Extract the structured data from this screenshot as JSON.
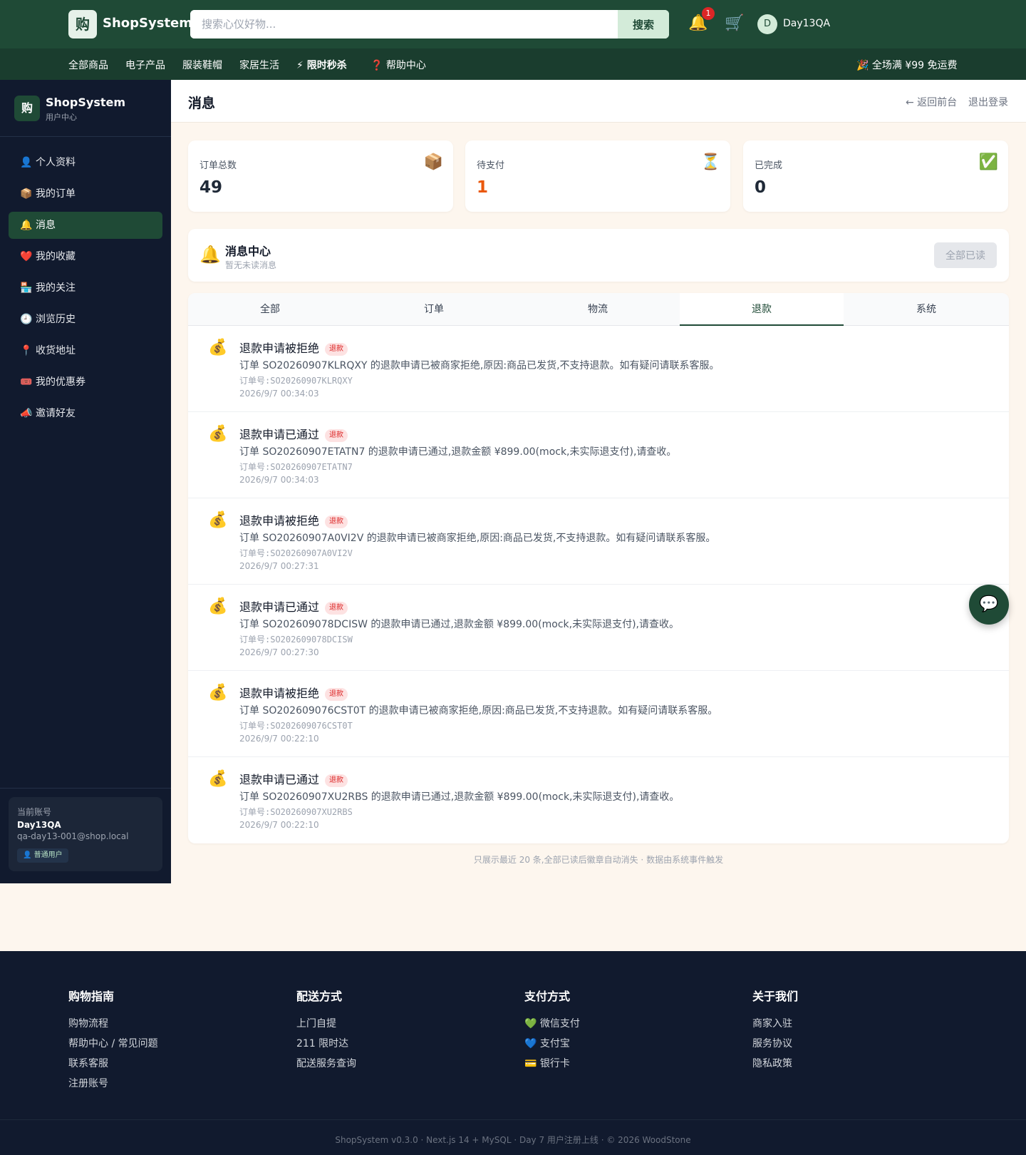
{
  "header": {
    "logo_char": "购",
    "brand": "ShopSystem",
    "search_placeholder": "搜索心仪好物...",
    "search_button": "搜索",
    "notification_count": "1",
    "user_initial": "D",
    "username": "Day13QA"
  },
  "nav": {
    "items": [
      "全部商品",
      "电子产品",
      "服装鞋帽",
      "家居生活",
      "⚡ 限时秒杀",
      "❓ 帮助中心"
    ],
    "promo": "🎉 全场满 ¥99 免运费"
  },
  "sidebar": {
    "logo_char": "购",
    "brand": "ShopSystem",
    "subtitle": "用户中心",
    "items": [
      {
        "icon": "👤",
        "label": "个人资料"
      },
      {
        "icon": "📦",
        "label": "我的订单"
      },
      {
        "icon": "🔔",
        "label": "消息"
      },
      {
        "icon": "❤️",
        "label": "我的收藏"
      },
      {
        "icon": "🏪",
        "label": "我的关注"
      },
      {
        "icon": "🕘",
        "label": "浏览历史"
      },
      {
        "icon": "📍",
        "label": "收货地址"
      },
      {
        "icon": "🎟️",
        "label": "我的优惠券"
      },
      {
        "icon": "📣",
        "label": "邀请好友"
      }
    ],
    "account": {
      "label": "当前账号",
      "name": "Day13QA",
      "email": "qa-day13-001@shop.local",
      "role": "👤 普通用户"
    }
  },
  "page": {
    "title": "消息",
    "back_link": "← 返回前台",
    "logout": "退出登录"
  },
  "stats": [
    {
      "label": "订单总数",
      "value": "49",
      "icon": "📦",
      "color": "#1f2937"
    },
    {
      "label": "待支付",
      "value": "1",
      "icon": "⏳",
      "color": "#ea580c"
    },
    {
      "label": "已完成",
      "value": "0",
      "icon": "✅",
      "color": "#1f2937"
    }
  ],
  "center": {
    "icon": "🔔",
    "title": "消息中心",
    "subtitle": "暂无未读消息",
    "mark_all": "全部已读"
  },
  "tabs": [
    "全部",
    "订单",
    "物流",
    "退款",
    "系统"
  ],
  "active_tab": "退款",
  "messages": [
    {
      "icon": "💰",
      "title": "退款申请被拒绝",
      "tag": "退款",
      "body": "订单 SO20260907KLRQXY 的退款申请已被商家拒绝,原因:商品已发货,不支持退款。如有疑问请联系客服。",
      "order": "订单号:SO20260907KLRQXY",
      "time": "2026/9/7 00:34:03"
    },
    {
      "icon": "💰",
      "title": "退款申请已通过",
      "tag": "退款",
      "body": "订单 SO20260907ETATN7 的退款申请已通过,退款金额 ¥899.00(mock,未实际退支付),请查收。",
      "order": "订单号:SO20260907ETATN7",
      "time": "2026/9/7 00:34:03"
    },
    {
      "icon": "💰",
      "title": "退款申请被拒绝",
      "tag": "退款",
      "body": "订单 SO20260907A0VI2V 的退款申请已被商家拒绝,原因:商品已发货,不支持退款。如有疑问请联系客服。",
      "order": "订单号:SO20260907A0VI2V",
      "time": "2026/9/7 00:27:31"
    },
    {
      "icon": "💰",
      "title": "退款申请已通过",
      "tag": "退款",
      "body": "订单 SO202609078DCISW 的退款申请已通过,退款金额 ¥899.00(mock,未实际退支付),请查收。",
      "order": "订单号:SO202609078DCISW",
      "time": "2026/9/7 00:27:30"
    },
    {
      "icon": "💰",
      "title": "退款申请被拒绝",
      "tag": "退款",
      "body": "订单 SO202609076CST0T 的退款申请已被商家拒绝,原因:商品已发货,不支持退款。如有疑问请联系客服。",
      "order": "订单号:SO202609076CST0T",
      "time": "2026/9/7 00:22:10"
    },
    {
      "icon": "💰",
      "title": "退款申请已通过",
      "tag": "退款",
      "body": "订单 SO20260907XU2RBS 的退款申请已通过,退款金额 ¥899.00(mock,未实际退支付),请查收。",
      "order": "订单号:SO20260907XU2RBS",
      "time": "2026/9/7 00:22:10"
    }
  ],
  "list_footer": "只展示最近 20 条,全部已读后徽章自动消失 · 数据由系统事件触发",
  "chat_icon": "💬",
  "footer": {
    "columns": [
      {
        "title": "购物指南",
        "links": [
          "购物流程",
          "帮助中心 / 常见问题",
          "联系客服",
          "注册账号"
        ]
      },
      {
        "title": "配送方式",
        "links": [
          "上门自提",
          "211 限时达",
          "配送服务查询"
        ]
      },
      {
        "title": "支付方式",
        "links": [
          "💚 微信支付",
          "💙 支付宝",
          "💳 银行卡"
        ]
      },
      {
        "title": "关于我们",
        "links": [
          "商家入驻",
          "服务协议",
          "隐私政策"
        ]
      }
    ],
    "copyright": "ShopSystem v0.3.0 · Next.js 14 + MySQL · Day 7 用户注册上线 · © 2026 WoodStone"
  }
}
